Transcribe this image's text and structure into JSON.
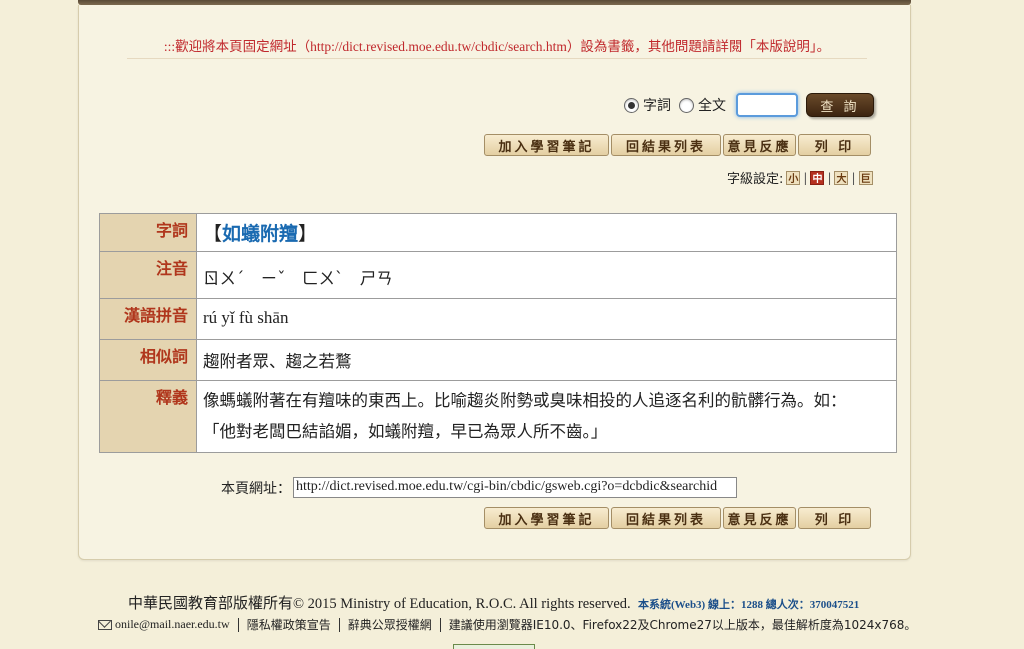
{
  "notice": ":::歡迎將本頁固定網址（http://dict.revised.moe.edu.tw/cbdic/search.htm）設為書籤，其他問題請詳閱「本版說明」。",
  "search": {
    "radio_word": "字詞",
    "radio_full": "全文",
    "input_value": "",
    "query_label": "查 詢"
  },
  "actions": {
    "add_notes": "加入學習筆記",
    "back_results": "回結果列表",
    "feedback": "意見反應",
    "print": "列 印"
  },
  "font_size": {
    "label": "字級設定:",
    "small": "小",
    "medium": "中",
    "large": "大",
    "huge": "巨",
    "selected": "中"
  },
  "entry": {
    "labels": {
      "word": "字詞",
      "zhuyin": "注音",
      "pinyin": "漢語拼音",
      "synonyms": "相似詞",
      "meaning": "釋義"
    },
    "word_open": "【",
    "word": "如蟻附羶",
    "word_close": "】",
    "zhuyin": "ㄖㄨˊ　ㄧˇ　ㄈㄨˋ　ㄕㄢ",
    "pinyin": "rú yǐ fù shān",
    "synonyms": "趨附者眾、趨之若鶩",
    "meaning_line1": "像螞蟻附著在有羶味的東西上。比喻趨炎附勢或臭味相投的人追逐名利的骯髒行為。如：",
    "meaning_line2": "「他對老闆巴結諂媚，如蟻附羶，早已為眾人所不齒。」"
  },
  "page_url": {
    "label": "本頁網址：",
    "value": "http://dict.revised.moe.edu.tw/cgi-bin/cbdic/gsweb.cgi?o=dcbdic&searchid"
  },
  "footer": {
    "copyright_cjk": "中華民國教育部版權所有",
    "copyright_en": "© 2015 Ministry of Education, R.O.C. All rights reserved.",
    "stats": "本系統(Web3) 線上：1288 總人次：370047521",
    "email": "onile@mail.naer.edu.tw",
    "privacy": "隱私權政策宣告",
    "license": "辭典公眾授權網",
    "browser_note": "建議使用瀏覽器IE10.0、Firefox22及Chrome27以上版本，最佳解析度為1024x768。"
  }
}
